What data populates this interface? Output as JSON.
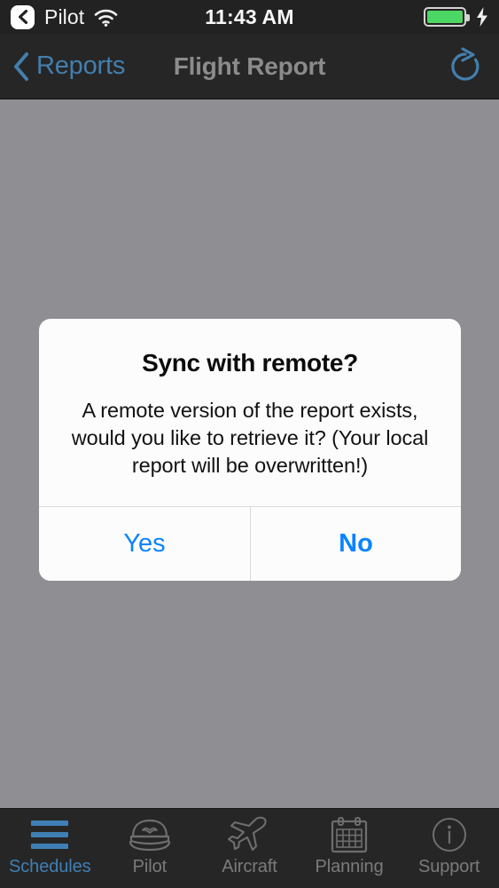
{
  "status_bar": {
    "back_chip_icon": "chevron-left-icon",
    "carrier": "Pilot",
    "wifi_icon": "wifi-icon",
    "time": "11:43 AM",
    "battery_icon": "battery-full-icon",
    "battery_level_percent": 100,
    "charging_icon": "lightning-bolt-icon"
  },
  "nav_bar": {
    "back_icon": "chevron-left-icon",
    "back_label": "Reports",
    "title": "Flight Report",
    "refresh_icon": "refresh-icon"
  },
  "alert": {
    "title": "Sync with remote?",
    "message": "A remote version of the report exists, would you like to retrieve it? (Your local report will be overwritten!)",
    "buttons": [
      {
        "label": "Yes",
        "style": "cancel"
      },
      {
        "label": "No",
        "style": "default"
      }
    ]
  },
  "tab_bar": {
    "items": [
      {
        "label": "Schedules",
        "icon": "hamburger-menu-icon",
        "active": true
      },
      {
        "label": "Pilot",
        "icon": "pilot-cap-icon",
        "active": false
      },
      {
        "label": "Aircraft",
        "icon": "airplane-icon",
        "active": false
      },
      {
        "label": "Planning",
        "icon": "calendar-icon",
        "active": false
      },
      {
        "label": "Support",
        "icon": "info-circle-icon",
        "active": false
      }
    ]
  },
  "colors": {
    "accent_blue": "#0a84ff",
    "dimmed_blue": "#3f7fb5",
    "nav_bar_bg": "#262626",
    "status_bar_bg": "#222222",
    "overlay_gray": "#8e8e93",
    "battery_green": "#4cd663",
    "alert_bg": "#fcfcfc"
  }
}
